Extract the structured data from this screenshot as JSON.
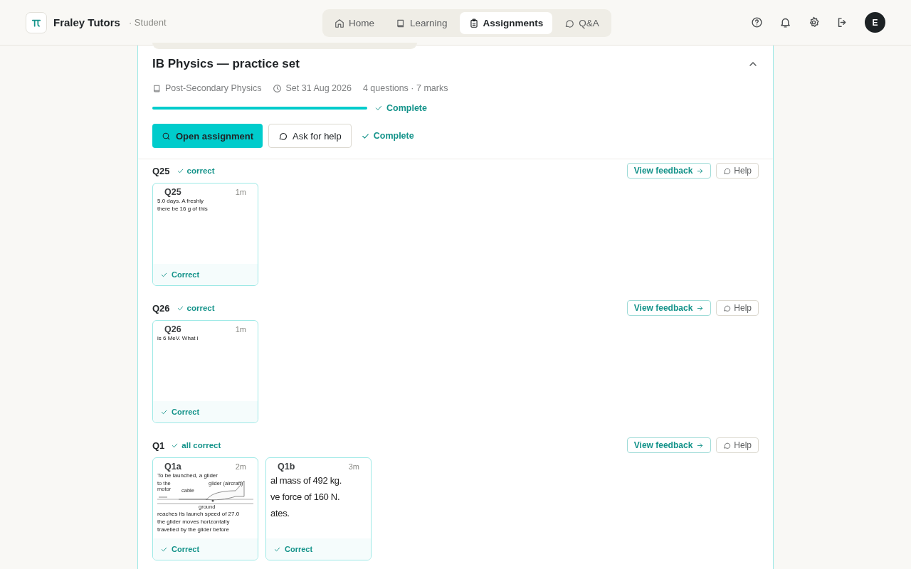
{
  "header": {
    "brand": "Fraley Tutors",
    "role": "· Student",
    "avatar": "E"
  },
  "nav": [
    {
      "label": "Home",
      "selected": false
    },
    {
      "label": "Learning",
      "selected": false
    },
    {
      "label": "Assignments",
      "selected": true
    },
    {
      "label": "Q&A",
      "selected": false
    }
  ],
  "assignment": {
    "title": "IB Physics — practice set",
    "expanded": true,
    "subject": "Post-Secondary Physics",
    "set_date": "Set 31 Aug 2026",
    "summary": "4 questions · 7 marks",
    "level": 1,
    "progress_status": "Complete",
    "open_button": "Open assignment",
    "help_button": "Ask for help",
    "status": "Complete"
  },
  "questions": [
    {
      "label": "Q25",
      "result": "correct",
      "feedback_button": "View feedback",
      "help_button": "Help",
      "parts": [
        {
          "kind": "page",
          "label": "Q25",
          "time": "1m",
          "status": "Correct",
          "excerpt": {
            "lines": [
              "5.0 days.  A freshly",
              "there be 16 g of this"
            ]
          }
        }
      ]
    },
    {
      "label": "Q26",
      "result": "correct",
      "feedback_button": "View feedback",
      "help_button": "Help",
      "parts": [
        {
          "kind": "page",
          "label": "Q26",
          "time": "1m",
          "status": "Correct",
          "excerpt": {
            "lines": [
              "is 6 MeV.  What i"
            ]
          }
        }
      ]
    },
    {
      "label": "Q1",
      "result": "all correct",
      "feedback_button": "View feedback",
      "help_button": "Help",
      "parts": [
        {
          "kind": "page",
          "label": "Q1a",
          "time": "2m",
          "status": "Correct",
          "excerpt": {
            "lines": [
              "To be launched, a glider"
            ],
            "diagram": [
              "to the motor",
              "cable",
              "glider (aircraft)",
              "ground"
            ],
            "lines_after": [
              "reaches its launch speed of 27.0",
              "the glider moves horizontally",
              "travelled by the glider before"
            ]
          }
        },
        {
          "kind": "zoomed",
          "label": "Q1b",
          "time": "3m",
          "status": "Correct",
          "excerpt": {
            "lines": [
              "al mass of 492 kg.",
              "ve force of 160 N.",
              "ates."
            ]
          }
        }
      ]
    }
  ]
}
